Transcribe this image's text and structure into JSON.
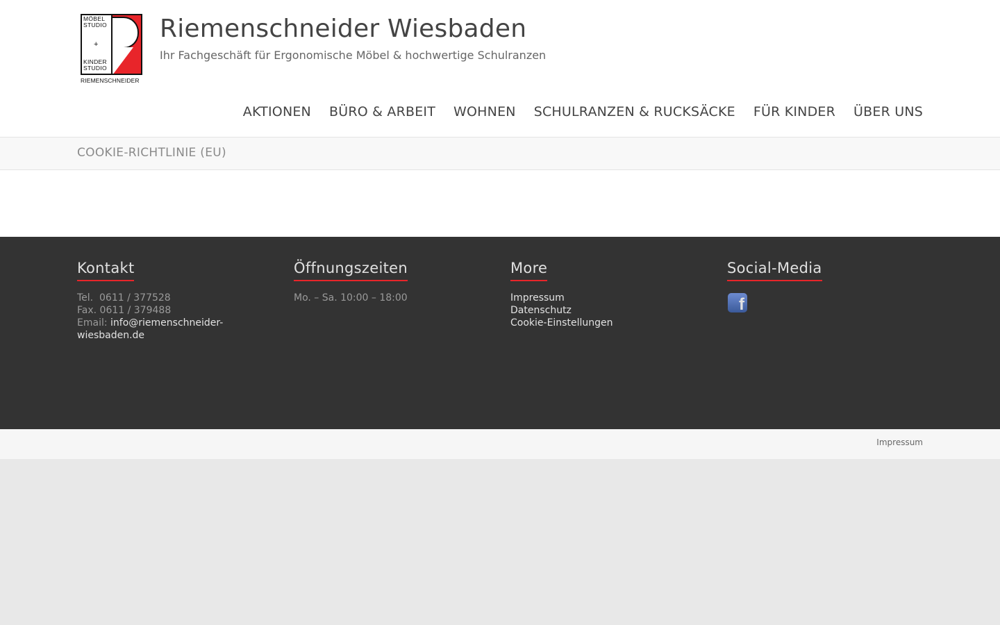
{
  "header": {
    "logo": {
      "top_text": [
        "MÖBEL",
        "STUDIO"
      ],
      "plus": "+",
      "bottom_text": [
        "KINDER",
        "STUDIO"
      ],
      "caption": "RIEMENSCHNEIDER"
    },
    "title": "Riemenschneider Wiesbaden",
    "tagline": "Ihr Fachgeschäft für Ergonomische Möbel & hochwertige Schulranzen"
  },
  "nav": {
    "items": [
      "AKTIONEN",
      "BÜRO & ARBEIT",
      "WOHNEN",
      "SCHULRANZEN & RUCKSÄCKE",
      "FÜR KINDER",
      "ÜBER UNS"
    ]
  },
  "page": {
    "title": "COOKIE-RICHTLINIE (EU)"
  },
  "footer": {
    "kontakt": {
      "heading": "Kontakt",
      "tel": "Tel.  0611 / 377528",
      "fax": "Fax. 0611 / 379488",
      "email_label": "Email: ",
      "email": "info@riemenschneider-wiesbaden.de"
    },
    "hours": {
      "heading": "Öffnungszeiten",
      "text": "Mo. – Sa. 10:00 – 18:00"
    },
    "more": {
      "heading": "More",
      "links": [
        "Impressum",
        "Datenschutz",
        "Cookie-Einstellungen"
      ]
    },
    "social": {
      "heading": "Social-Media",
      "icon": "facebook-icon",
      "icon_glyph": "f"
    },
    "bottom_link": "Impressum"
  },
  "colors": {
    "accent": "#e8252a",
    "footer_bg": "#333333",
    "page_bg": "#e8e8e8"
  }
}
